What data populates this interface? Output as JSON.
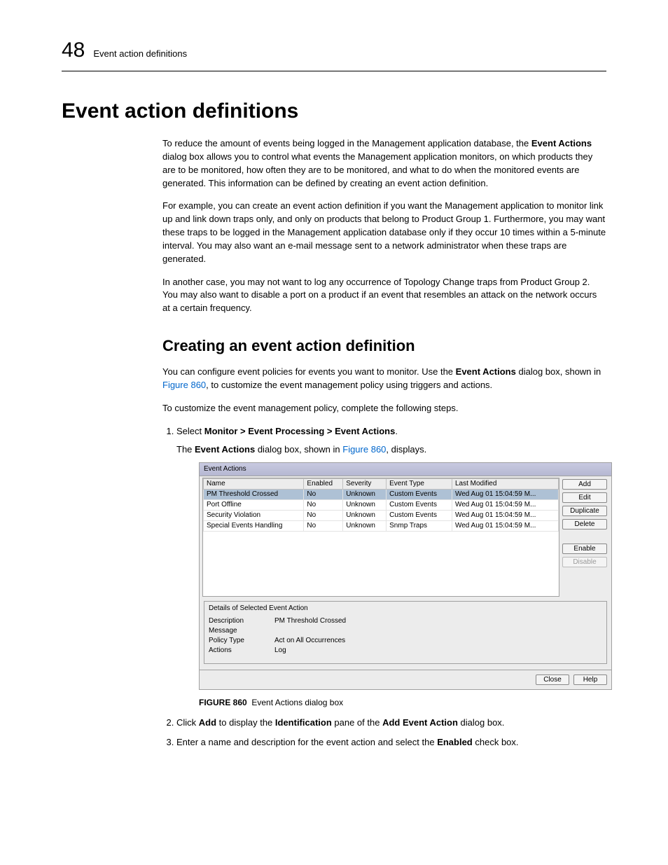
{
  "header": {
    "chapnum": "48",
    "chaptitle": "Event action definitions"
  },
  "h1": "Event action definitions",
  "para1a": "To reduce the amount of events being logged in the Management application database, the ",
  "para1b": "Event Actions",
  "para1c": " dialog box allows you to control what events the Management application monitors, on which products they are to be monitored, how often they are to be monitored, and what to do when the monitored events are generated. This information can be defined by creating an event action definition.",
  "para2": "For example, you can create an event action definition if you want the Management application to monitor link up and link down traps only, and only on products that belong to Product Group 1. Furthermore, you may want these traps to be logged in the Management application database only if they occur 10 times within a 5-minute interval. You may also want an e-mail message sent to a network administrator when these traps are generated.",
  "para3": "In another case, you may not want to log any occurrence of Topology Change traps from Product Group 2. You may also want to disable a port on a product if an event that resembles an attack on the network occurs at a certain frequency.",
  "h2": "Creating an event action definition",
  "para4a": "You can configure event policies for events you want to monitor. Use the ",
  "para4b": "Event Actions",
  "para4c": " dialog box, shown in ",
  "para4d": "Figure 860",
  "para4e": ", to customize the event management policy using triggers and actions.",
  "para5": "To customize the event management policy, complete the following steps.",
  "step1a": "Select ",
  "step1b": "Monitor > Event Processing > Event Actions",
  "step1c": ".",
  "step1_body_a": "The ",
  "step1_body_b": "Event Actions",
  "step1_body_c": " dialog box, shown in ",
  "step1_body_d": "Figure 860",
  "step1_body_e": ", displays.",
  "dialog": {
    "title": "Event Actions",
    "columns": [
      "Name",
      "Enabled",
      "Severity",
      "Event Type",
      "Last Modified"
    ],
    "rows": [
      {
        "name": "PM Threshold Crossed",
        "enabled": "No",
        "severity": "Unknown",
        "etype": "Custom Events",
        "lm": "Wed Aug 01 15:04:59 M...",
        "sel": true
      },
      {
        "name": "Port Offline",
        "enabled": "No",
        "severity": "Unknown",
        "etype": "Custom Events",
        "lm": "Wed Aug 01 15:04:59 M...",
        "sel": false
      },
      {
        "name": "Security Violation",
        "enabled": "No",
        "severity": "Unknown",
        "etype": "Custom Events",
        "lm": "Wed Aug 01 15:04:59 M...",
        "sel": false
      },
      {
        "name": "Special Events Handling",
        "enabled": "No",
        "severity": "Unknown",
        "etype": "Snmp Traps",
        "lm": "Wed Aug 01 15:04:59 M...",
        "sel": false
      }
    ],
    "buttons": {
      "add": "Add",
      "edit": "Edit",
      "duplicate": "Duplicate",
      "delete": "Delete",
      "enable": "Enable",
      "disable": "Disable"
    },
    "details": {
      "title": "Details of Selected Event Action",
      "desc_k": "Description",
      "desc_v": "PM Threshold Crossed",
      "msg_k": "Message",
      "msg_v": "",
      "pol_k": "Policy Type",
      "pol_v": "Act on All Occurrences",
      "act_k": "Actions",
      "act_v": "Log"
    },
    "footer": {
      "close": "Close",
      "help": "Help"
    }
  },
  "figcap_a": "FIGURE 860",
  "figcap_b": "Event Actions dialog box",
  "step2a": "Click ",
  "step2b": "Add",
  "step2c": " to display the ",
  "step2d": "Identification",
  "step2e": " pane of the ",
  "step2f": "Add Event Action",
  "step2g": " dialog box.",
  "step3a": "Enter a name and description for the event action and select the ",
  "step3b": "Enabled",
  "step3c": " check box."
}
